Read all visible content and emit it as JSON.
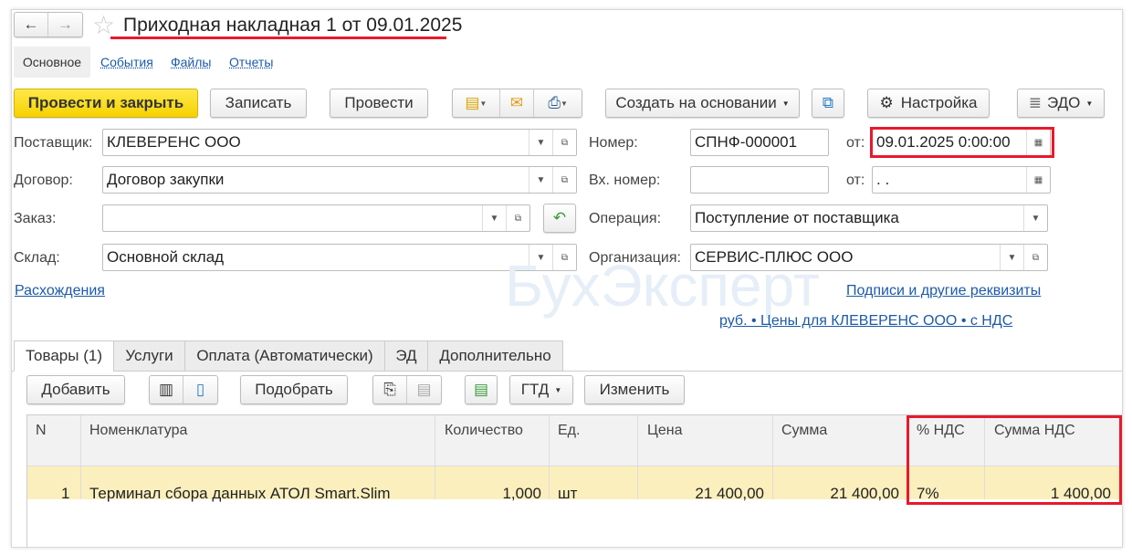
{
  "header": {
    "title": "Приходная накладная 1 от 09.01.2025",
    "back": "←",
    "forward": "→",
    "star": "☆"
  },
  "nav_tabs": [
    {
      "label": "Основное"
    },
    {
      "label": "События"
    },
    {
      "label": "Файлы"
    },
    {
      "label": "Отчеты"
    }
  ],
  "toolbar": {
    "post_close": "Провести и закрыть",
    "save": "Записать",
    "post": "Провести",
    "create_based": "Создать на основании",
    "settings": "Настройка",
    "edo": "ЭДО"
  },
  "form": {
    "supplier_label": "Поставщик:",
    "supplier": "КЛЕВЕРЕНС ООО",
    "contract_label": "Договор:",
    "contract": "Договор закупки",
    "order_label": "Заказ:",
    "order": "",
    "warehouse_label": "Склад:",
    "warehouse": "Основной склад",
    "number_label": "Номер:",
    "number": "СПНФ-000001",
    "date_label": "от:",
    "date": "09.01.2025  0:00:00",
    "in_number_label": "Вх. номер:",
    "in_number": "",
    "in_date_label": "от:",
    "in_date": " .  .",
    "operation_label": "Операция:",
    "operation": "Поступление от поставщика",
    "org_label": "Организация:",
    "org": "СЕРВИС-ПЛЮС ООО",
    "discrepancies": "Расхождения",
    "signatures": "Подписи и другие реквизиты",
    "prices": "руб. • Цены для КЛЕВЕРЕНС ООО • с НДС"
  },
  "watermark": "БухЭксперт",
  "doc_tabs": [
    {
      "label": "Товары (1)"
    },
    {
      "label": "Услуги"
    },
    {
      "label": "Оплата (Автоматически)"
    },
    {
      "label": "ЭД"
    },
    {
      "label": "Дополнительно"
    }
  ],
  "table_toolbar": {
    "add": "Добавить",
    "pick": "Подобрать",
    "gtd": "ГТД",
    "change": "Изменить"
  },
  "table": {
    "columns": [
      "N",
      "Номенклатура",
      "Количество",
      "Ед.",
      "Цена",
      "Сумма",
      "% НДС",
      "Сумма НДС"
    ],
    "rows": [
      {
        "n": "1",
        "item": "Терминал сбора данных АТОЛ Smart.Slim",
        "qty": "1,000",
        "unit": "шт",
        "price": "21 400,00",
        "sum": "21 400,00",
        "vat_rate": "7%",
        "vat_sum": "1 400,00"
      }
    ]
  }
}
